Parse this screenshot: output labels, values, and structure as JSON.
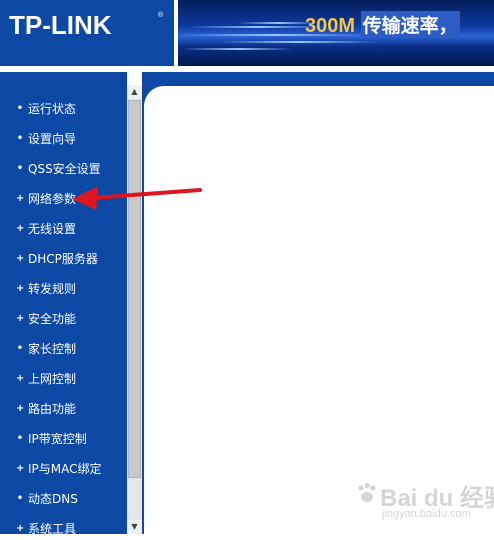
{
  "header": {
    "logo_text": "TP-LINK",
    "logo_reg_mark": "®",
    "banner_speed": "300M",
    "banner_text": "传输速率，"
  },
  "sidebar": {
    "items": [
      {
        "label": "运行状态",
        "marker": "•",
        "icon": "bullet-icon"
      },
      {
        "label": "设置向导",
        "marker": "•",
        "icon": "bullet-icon"
      },
      {
        "label": "QSS安全设置",
        "marker": "•",
        "icon": "bullet-icon"
      },
      {
        "label": "网络参数",
        "marker": "+",
        "icon": "plus-icon"
      },
      {
        "label": "无线设置",
        "marker": "+",
        "icon": "plus-icon"
      },
      {
        "label": "DHCP服务器",
        "marker": "+",
        "icon": "plus-icon"
      },
      {
        "label": "转发规则",
        "marker": "+",
        "icon": "plus-icon"
      },
      {
        "label": "安全功能",
        "marker": "+",
        "icon": "plus-icon"
      },
      {
        "label": "家长控制",
        "marker": "•",
        "icon": "bullet-icon"
      },
      {
        "label": "上网控制",
        "marker": "+",
        "icon": "plus-icon"
      },
      {
        "label": "路由功能",
        "marker": "+",
        "icon": "plus-icon"
      },
      {
        "label": "IP带宽控制",
        "marker": "•",
        "icon": "bullet-icon"
      },
      {
        "label": "IP与MAC绑定",
        "marker": "+",
        "icon": "plus-icon"
      },
      {
        "label": "动态DNS",
        "marker": "•",
        "icon": "bullet-icon"
      },
      {
        "label": "系统工具",
        "marker": "+",
        "icon": "plus-icon"
      }
    ]
  },
  "scrollbar": {
    "up_arrow": "▲",
    "down_arrow": "▼"
  },
  "watermark": {
    "text": "Bai du 经验",
    "sub": "jingyan.baidu.com"
  },
  "colors": {
    "sidebar_bg": "#0d49a4",
    "header_bg": "#0b3f8e",
    "banner_speed": "#f1c64a",
    "arrow": "#e0141e"
  }
}
